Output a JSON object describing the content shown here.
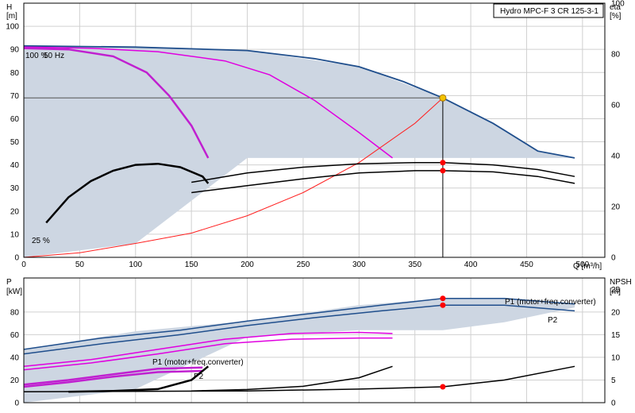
{
  "chart_data": [
    {
      "type": "line",
      "title": "Hydro MPC-F 3 CR 125-3-1",
      "xlabel": "Q [m³/h]",
      "x_unit_label": "Q [m³/h]",
      "ylabel_left_name": "H",
      "ylabel_left_unit": "[m]",
      "ylabel_right_name": "eta",
      "ylabel_right_unit": "[%]",
      "xlim": [
        0,
        520
      ],
      "ylim_left": [
        0,
        110
      ],
      "ylim_right": [
        0,
        100
      ],
      "x_ticks": [
        0,
        50,
        100,
        150,
        200,
        250,
        300,
        350,
        400,
        450,
        500
      ],
      "y_ticks_left": [
        0,
        10,
        20,
        30,
        40,
        50,
        60,
        70,
        80,
        90,
        100
      ],
      "y_ticks_right": [
        0,
        20,
        40,
        60,
        80,
        100
      ],
      "grid": true,
      "annotations": [
        "100 %",
        "50 Hz",
        "25 %"
      ],
      "duty_point": {
        "q": 375,
        "h": 69
      },
      "series": [
        {
          "role": "H max",
          "color": "#1f4e8c",
          "x": [
            0,
            100,
            200,
            260,
            300,
            340,
            375,
            420,
            460,
            493
          ],
          "y": [
            91.5,
            91,
            89.5,
            86,
            82.5,
            76,
            69,
            58,
            46,
            43
          ]
        },
        {
          "role": "H mid",
          "color": "#e000e0",
          "x": [
            0,
            60,
            120,
            180,
            220,
            260,
            300,
            330
          ],
          "y": [
            91,
            90.5,
            89,
            85,
            79,
            68,
            54,
            43
          ]
        },
        {
          "role": "H low",
          "color": "#c020d0",
          "x": [
            0,
            40,
            80,
            110,
            130,
            150,
            165
          ],
          "y": [
            90.5,
            90,
            87,
            80,
            70,
            57,
            43
          ]
        },
        {
          "role": "system curve",
          "color": "#ff2020",
          "x": [
            0,
            50,
            100,
            150,
            200,
            250,
            300,
            350,
            375
          ],
          "y": [
            0,
            2,
            6,
            10.5,
            18,
            28,
            41,
            58,
            69
          ]
        },
        {
          "role": "eta 1",
          "color": "#000000",
          "x": [
            150,
            200,
            250,
            300,
            350,
            375,
            420,
            460,
            493
          ],
          "y": [
            32.5,
            36.5,
            39,
            40.5,
            41,
            41,
            40,
            38,
            35
          ]
        },
        {
          "role": "eta 2",
          "color": "#000000",
          "x": [
            150,
            200,
            250,
            300,
            350,
            375,
            420,
            460,
            493
          ],
          "y": [
            28,
            31,
            34,
            36.5,
            37.5,
            37.5,
            37,
            35,
            32
          ]
        },
        {
          "role": "eta small",
          "color": "#000000",
          "x": [
            20,
            40,
            60,
            80,
            100,
            120,
            140,
            160,
            165
          ],
          "y": [
            15,
            26,
            33,
            37.5,
            40,
            40.5,
            39,
            35,
            32
          ]
        }
      ],
      "shaded_region": {
        "x": [
          0,
          100,
          200,
          300,
          375,
          420,
          460,
          493
        ],
        "top": [
          91.5,
          91,
          89.5,
          82.5,
          69,
          58,
          46,
          43
        ],
        "bottom": [
          0,
          6,
          43,
          43,
          43,
          43,
          43,
          43
        ]
      }
    },
    {
      "type": "line",
      "xlabel": "",
      "ylabel_left_name": "P",
      "ylabel_left_unit": "[kW]",
      "ylabel_right_name": "NPSH",
      "ylabel_right_unit": "[m]",
      "xlim": [
        0,
        520
      ],
      "ylim_left": [
        0,
        110
      ],
      "ylim_right": [
        0,
        27.5
      ],
      "y_ticks_left": [
        0,
        20,
        40,
        60,
        80
      ],
      "y_ticks_right": [
        0,
        5,
        10,
        15,
        20,
        25
      ],
      "grid": true,
      "labels": [
        "P1 (motor+freq.converter)",
        "P2",
        "P1 (motor+freq.converter)",
        "P2"
      ],
      "duty_point": {
        "q": 375,
        "p1": 92,
        "p2": 86,
        "npsh": 3.5
      },
      "series": [
        {
          "role": "P1 max",
          "color": "#1f4e8c",
          "x": [
            0,
            70,
            140,
            200,
            260,
            320,
            375,
            430,
            493
          ],
          "y": [
            47,
            57,
            64,
            72,
            79,
            86,
            92,
            92,
            87
          ]
        },
        {
          "role": "P2 max",
          "color": "#1f4e8c",
          "x": [
            0,
            70,
            140,
            200,
            260,
            320,
            375,
            430,
            493
          ],
          "y": [
            43,
            52,
            60,
            68,
            75,
            81,
            86,
            86,
            81
          ]
        },
        {
          "role": "P1 mid",
          "color": "#e000e0",
          "x": [
            0,
            60,
            120,
            180,
            240,
            300,
            330
          ],
          "y": [
            32,
            38,
            47,
            56,
            61,
            62,
            61
          ]
        },
        {
          "role": "P2 mid",
          "color": "#e000e0",
          "x": [
            0,
            60,
            120,
            180,
            240,
            300,
            330
          ],
          "y": [
            29,
            35,
            43,
            52,
            56,
            57,
            57
          ]
        },
        {
          "role": "P1 low",
          "color": "#c020d0",
          "x": [
            0,
            40,
            80,
            120,
            160
          ],
          "y": [
            16,
            20,
            25,
            30,
            31
          ]
        },
        {
          "role": "P2 low",
          "color": "#c020d0",
          "x": [
            0,
            40,
            80,
            120,
            160
          ],
          "y": [
            14,
            18,
            23,
            27,
            28
          ]
        },
        {
          "role": "NPSH max",
          "color": "#000000",
          "x": [
            0,
            100,
            200,
            300,
            375,
            430,
            493
          ],
          "y": [
            2.4,
            2.5,
            2.6,
            3.0,
            3.5,
            5.0,
            8.0
          ]
        },
        {
          "role": "NPSH mid",
          "color": "#000000",
          "x": [
            150,
            200,
            250,
            300,
            330
          ],
          "y": [
            2.6,
            2.9,
            3.6,
            5.5,
            8.0
          ]
        },
        {
          "role": "NPSH low",
          "color": "#000000",
          "x": [
            40,
            80,
            120,
            150,
            165
          ],
          "y": [
            2.4,
            2.6,
            3.0,
            5.0,
            8.0
          ]
        }
      ],
      "shaded_region": {
        "x": [
          0,
          100,
          200,
          300,
          375,
          430,
          493
        ],
        "top": [
          47,
          63,
          72,
          86,
          92,
          92,
          87
        ],
        "bottom": [
          0,
          12,
          58,
          64,
          64,
          71,
          84
        ]
      }
    }
  ]
}
